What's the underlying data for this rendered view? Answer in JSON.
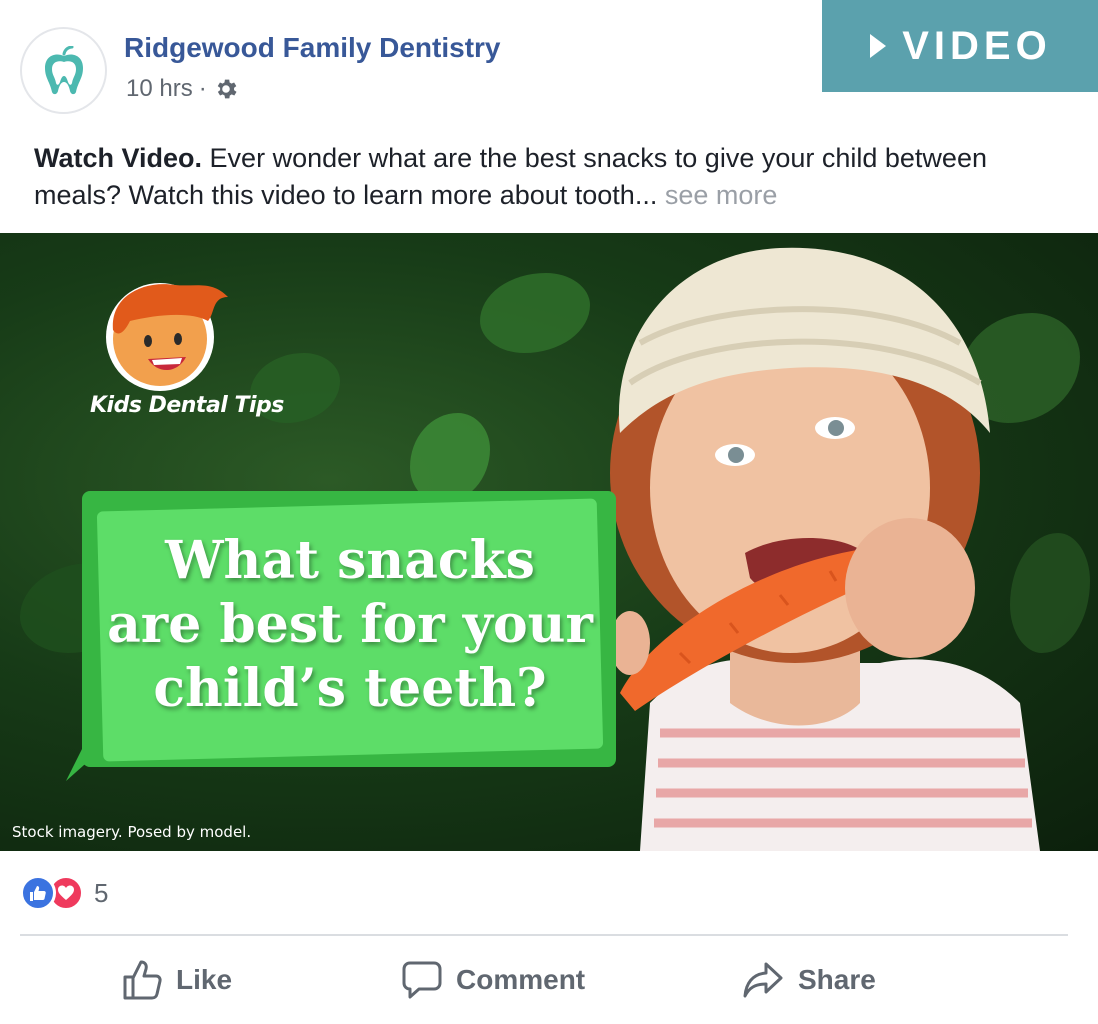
{
  "post": {
    "page_name": "Ridgewood Family Dentistry",
    "timestamp": "10 hrs",
    "separator": "·",
    "privacy_icon": "gear-icon",
    "avatar_icon": "tooth-apple-icon",
    "badge_label": "VIDEO",
    "badge_icon": "play-triangle-icon",
    "text_lead": "Watch Video.",
    "text_body": "Ever wonder what are the best snacks to give your child between meals? Watch this video to learn more about tooth...",
    "see_more": "see more"
  },
  "media": {
    "brand_label": "Kids Dental Tips",
    "headline_line1": "What snacks",
    "headline_line2": "are best for your",
    "headline_line3": "child’s teeth?",
    "disclaimer": "Stock imagery. Posed by model."
  },
  "reactions": {
    "count": "5",
    "icons": [
      "like-reaction-icon",
      "love-reaction-icon"
    ]
  },
  "actions": {
    "like": "Like",
    "comment": "Comment",
    "share": "Share"
  },
  "colors": {
    "page_link": "#385898",
    "video_badge": "#5ba1ad",
    "bubble_green": "#5ddd68",
    "like_blue": "#3b73e0",
    "love_red": "#ef3a5d"
  }
}
